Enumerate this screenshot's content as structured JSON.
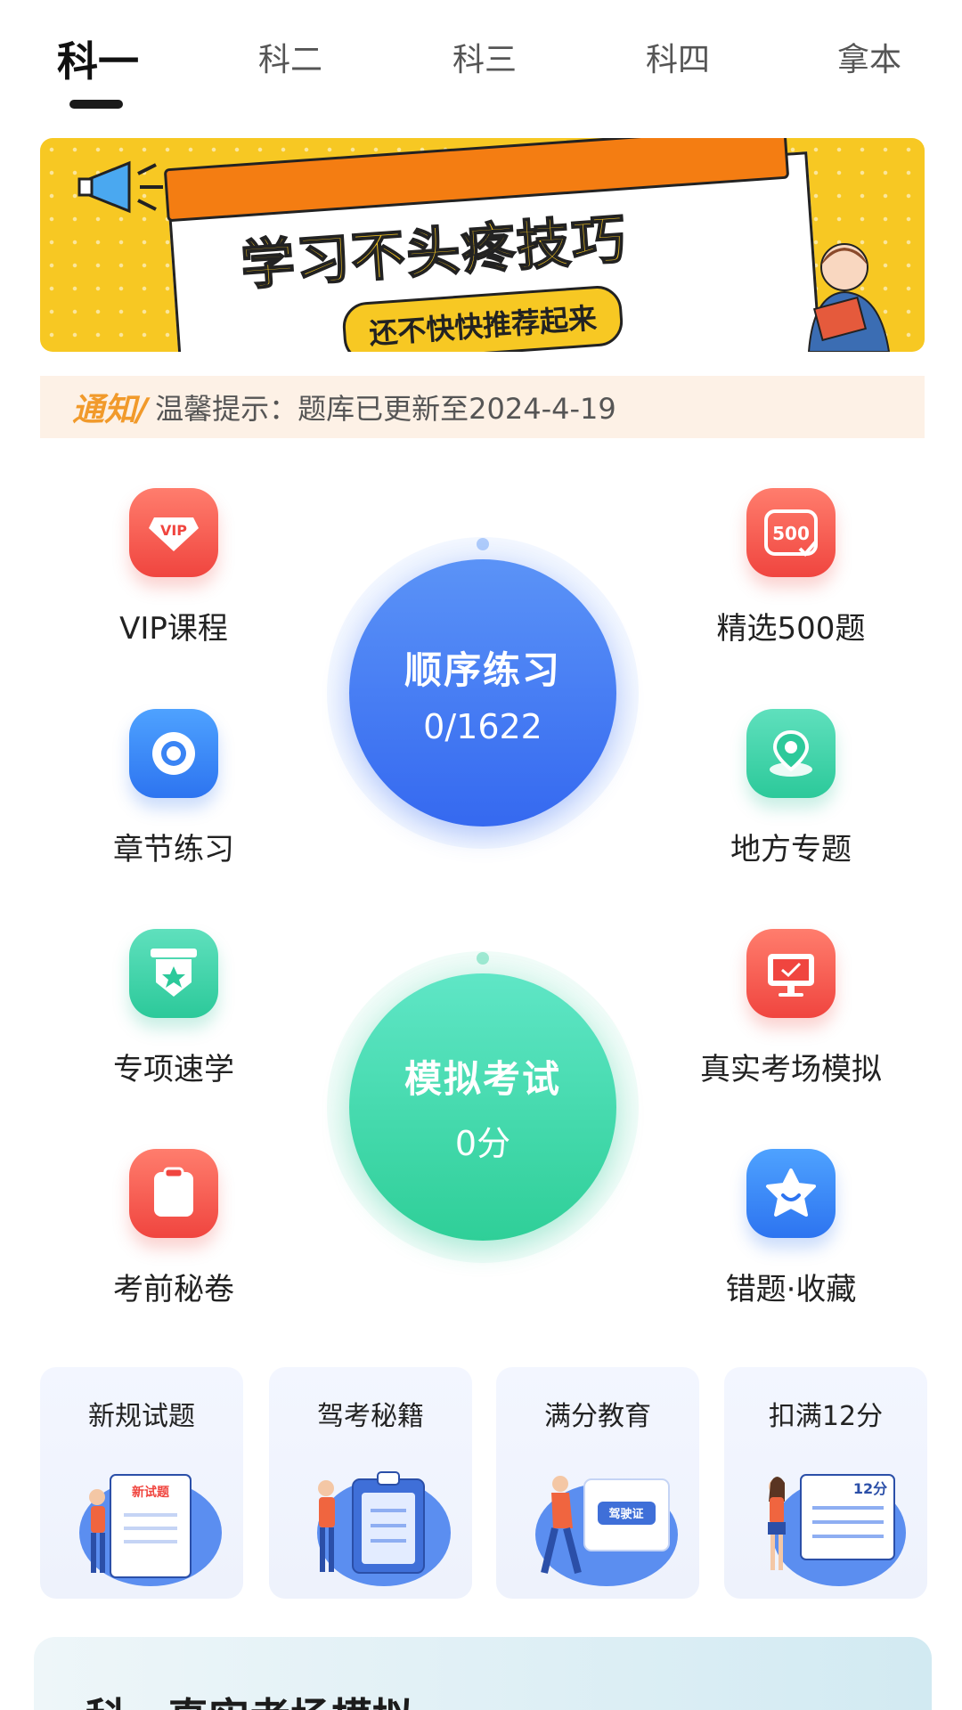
{
  "tabs": [
    "科一",
    "科二",
    "科三",
    "科四",
    "拿本"
  ],
  "banner": {
    "title": "学习不头疼技巧",
    "subtitle": "还不快快推荐起来"
  },
  "notice": {
    "tag": "通知/",
    "text": "温馨提示：题库已更新至2024-4-19"
  },
  "left_items": [
    {
      "label": "VIP课程",
      "icon": "vip-icon"
    },
    {
      "label": "章节练习",
      "icon": "chapter-icon"
    },
    {
      "label": "专项速学",
      "icon": "badge-icon"
    },
    {
      "label": "考前秘卷",
      "icon": "clipboard-icon"
    }
  ],
  "right_items": [
    {
      "label": "精选500题",
      "icon": "500-icon"
    },
    {
      "label": "地方专题",
      "icon": "location-icon"
    },
    {
      "label": "真实考场模拟",
      "icon": "monitor-icon"
    },
    {
      "label": "错题·收藏",
      "icon": "star-icon"
    }
  ],
  "practice": {
    "title": "顺序练习",
    "progress": "0/1622"
  },
  "exam": {
    "title": "模拟考试",
    "score": "0分"
  },
  "cards": [
    {
      "title": "新规试题",
      "art_text": "新试题"
    },
    {
      "title": "驾考秘籍",
      "art_text": ""
    },
    {
      "title": "满分教育",
      "art_text": "驾驶证"
    },
    {
      "title": "扣满12分",
      "art_text": "12分"
    }
  ],
  "bottom": {
    "title": "科一真实考场模拟"
  },
  "colors": {
    "accent_blue": "#3d7bf4",
    "accent_green": "#3fd6a9",
    "notice_orange": "#f19a2b",
    "banner_yellow": "#f7c823"
  }
}
